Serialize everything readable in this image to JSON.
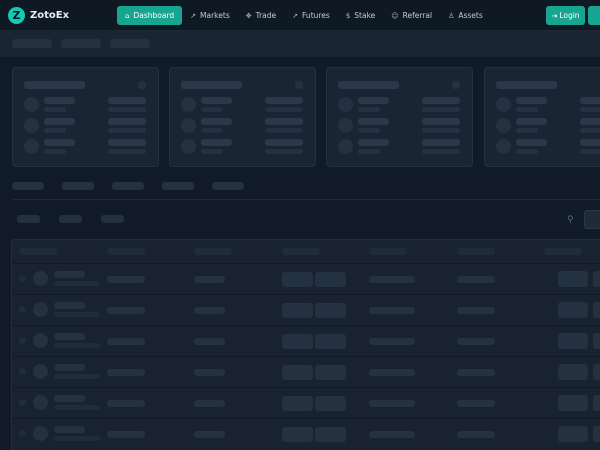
{
  "brand": {
    "name": "ZotoEx",
    "logo_letter": "Z",
    "accent": "#17a58f"
  },
  "nav": [
    {
      "label": "Dashboard",
      "icon": "home-icon",
      "glyph": "⌂",
      "active": true
    },
    {
      "label": "Markets",
      "icon": "trend-icon",
      "glyph": "↗",
      "active": false
    },
    {
      "label": "Trade",
      "icon": "exchange-icon",
      "glyph": "✥",
      "active": false
    },
    {
      "label": "Futures",
      "icon": "trend-icon",
      "glyph": "↗",
      "active": false
    },
    {
      "label": "Stake",
      "icon": "dollar-icon",
      "glyph": "$",
      "active": false
    },
    {
      "label": "Referral",
      "icon": "users-icon",
      "glyph": "☺",
      "active": false
    },
    {
      "label": "Assets",
      "icon": "user-icon",
      "glyph": "♙",
      "active": false
    }
  ],
  "auth": {
    "login_label": "Login",
    "login_icon": "login-icon",
    "login_glyph": "⇥"
  },
  "loading_state": "skeleton",
  "icons": {
    "search": "search-icon",
    "search_glyph": "⚲"
  }
}
